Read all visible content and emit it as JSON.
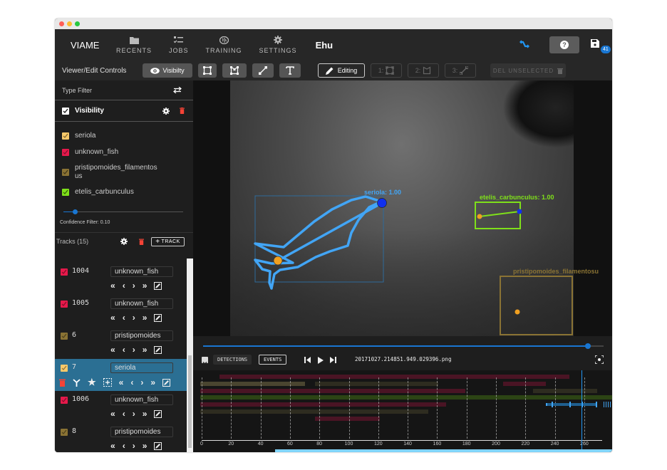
{
  "window": {
    "traffic_lights": [
      "#fe5f57",
      "#febc2e",
      "#28c840"
    ]
  },
  "topbar": {
    "brand": "VIAME",
    "nav": [
      {
        "label": "RECENTS",
        "icon": "folder-icon"
      },
      {
        "label": "JOBS",
        "icon": "checklist-icon"
      },
      {
        "label": "TRAINING",
        "icon": "brain-icon"
      },
      {
        "label": "SETTINGS",
        "icon": "gear-icon"
      }
    ],
    "dataset_name": "Ehu",
    "save_badge": "41"
  },
  "toolbar": {
    "label": "Viewer/Edit Controls",
    "visibility": "Visibilty",
    "editing": "Editing",
    "mode_rect": "1:",
    "mode_poly": "2:",
    "mode_line": "3:",
    "del_unselected": "DEL UNSELECTED"
  },
  "type_filter": {
    "title": "Type Filter",
    "header": "Visibility",
    "types": [
      {
        "name": "seriola",
        "color": "#f7c96a",
        "checked": true
      },
      {
        "name": "unknown_fish",
        "color": "#e6194b",
        "checked": true
      },
      {
        "name": "pristipomoides_filamentosus",
        "color": "#8a7334",
        "checked": true
      },
      {
        "name": "etelis_carbunculus",
        "color": "#7fe01a",
        "checked": true
      }
    ],
    "confidence_label": "Confidence Filter: 0.10",
    "confidence_value": 0.1
  },
  "tracks": {
    "title": "Tracks (15)",
    "add_label": "TRACK",
    "items": [
      {
        "id": "1004",
        "type": "unknown_fish",
        "color": "#e6194b",
        "selected": false
      },
      {
        "id": "1005",
        "type": "unknown_fish",
        "color": "#e6194b",
        "selected": false
      },
      {
        "id": "6",
        "type": "pristipomoides",
        "color": "#8a7334",
        "selected": false
      },
      {
        "id": "7",
        "type": "seriola",
        "color": "#f7c96a",
        "selected": true
      },
      {
        "id": "1006",
        "type": "unknown_fish",
        "color": "#e6194b",
        "selected": false
      },
      {
        "id": "8",
        "type": "pristipomoides",
        "color": "#8a7334",
        "selected": false
      }
    ]
  },
  "annotations": [
    {
      "label": "seriola: 1.00",
      "color": "#42a5f5"
    },
    {
      "label": "etelis_carbunculus: 1.00",
      "color": "#7fe01a"
    },
    {
      "label": "pristipomoides_filamentosu",
      "color": "#8a7334"
    }
  ],
  "playback": {
    "progress": 0.96,
    "detections_label": "DETECTIONS",
    "events_label": "EVENTS",
    "filename": "20171027.214851.949.029396.png"
  },
  "timeline": {
    "ticks": [
      "0",
      "20",
      "40",
      "60",
      "80",
      "100",
      "120",
      "140",
      "160",
      "180",
      "200",
      "220",
      "240",
      "260"
    ],
    "current_frame": 258,
    "max_frame": 278,
    "rows": [
      [
        {
          "s": 12,
          "e": 250,
          "c": "#4a1424"
        }
      ],
      [
        {
          "s": -1,
          "e": 70,
          "c": "#4a4530"
        },
        {
          "s": 77,
          "e": 161,
          "c": "#2e2c20"
        },
        {
          "s": 205,
          "e": 234,
          "c": "#4a1424"
        }
      ],
      [
        {
          "s": -1,
          "e": 179,
          "c": "#4a1424"
        },
        {
          "s": 225,
          "e": 269,
          "c": "#2e2c20"
        }
      ],
      [
        {
          "s": -1,
          "e": 300,
          "c": "#2c4414"
        }
      ],
      [
        {
          "s": -1,
          "e": 166,
          "c": "#4a1424"
        }
      ],
      [
        {
          "s": -1,
          "e": 154,
          "c": "#2e2c20"
        }
      ],
      [
        {
          "s": 77,
          "e": 121,
          "c": "#4a1424"
        }
      ]
    ],
    "selected_span": {
      "s": 234,
      "e": 268
    }
  }
}
